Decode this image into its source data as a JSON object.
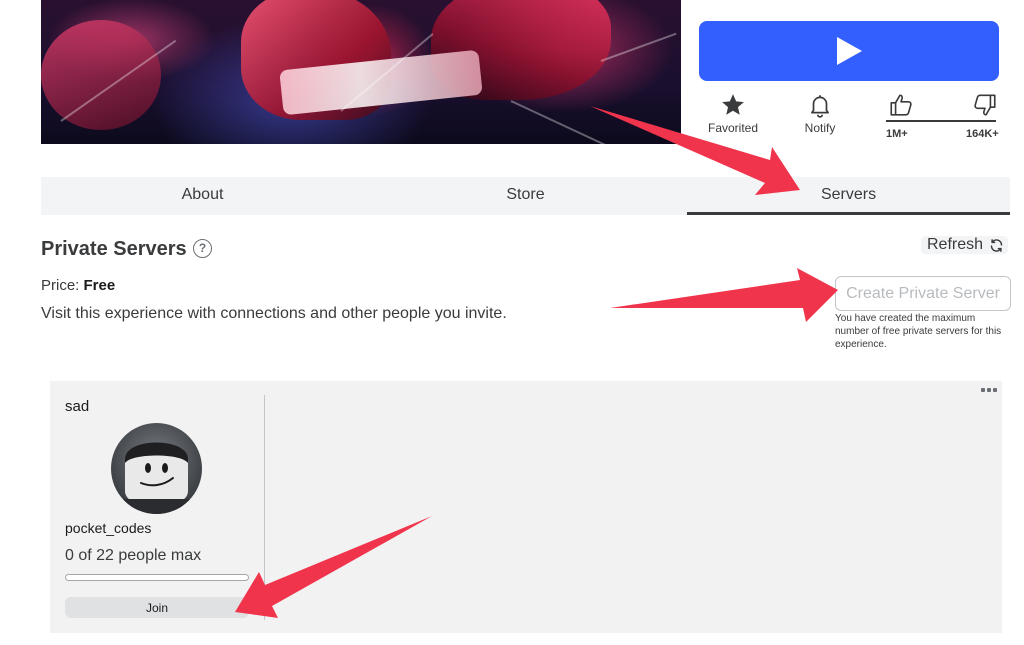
{
  "hero": {
    "image_name": "game-thumbnail"
  },
  "play_button": {
    "icon": "play-icon"
  },
  "actions": {
    "favorite": {
      "label": "Favorited",
      "icon": "star-icon"
    },
    "notify": {
      "label": "Notify",
      "icon": "bell-icon"
    },
    "upvote": {
      "count": "1M+",
      "icon": "thumbs-up-icon"
    },
    "downvote": {
      "count": "164K+",
      "icon": "thumbs-down-icon"
    },
    "upvote_fraction": 0.86
  },
  "tabs": [
    {
      "label": "About",
      "active": false
    },
    {
      "label": "Store",
      "active": false
    },
    {
      "label": "Servers",
      "active": true
    }
  ],
  "private_servers": {
    "title": "Private Servers",
    "help_glyph": "?",
    "refresh_label": "Refresh",
    "price_label": "Price:",
    "price_value": "Free",
    "description": "Visit this experience with connections and other people you invite.",
    "create_button": "Create Private Server",
    "create_note": "You have created the maximum number of free private servers for this experience."
  },
  "server_card": {
    "name": "sad",
    "owner": "pocket_codes",
    "capacity_text": "0 of 22 people max",
    "players": 0,
    "max_players": 22,
    "join_label": "Join"
  },
  "colors": {
    "accent": "#335fff",
    "arrow": "#f0344c",
    "text": "#393b3d"
  }
}
